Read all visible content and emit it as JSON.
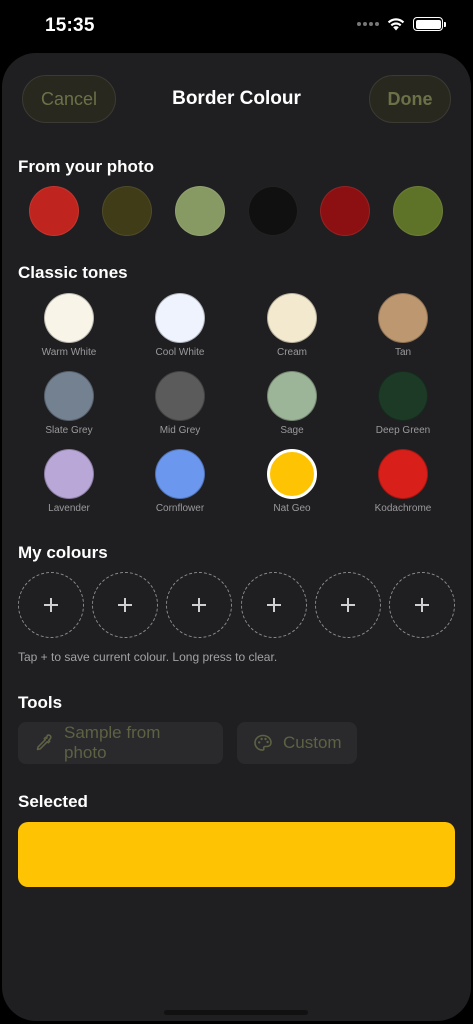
{
  "status_bar": {
    "time": "15:35"
  },
  "header": {
    "title": "Border Colour",
    "cancel_label": "Cancel",
    "done_label": "Done"
  },
  "photo_section": {
    "title": "From your photo",
    "swatches": [
      "#c0241e",
      "#3f3c17",
      "#889a64",
      "#0f100f",
      "#8c1012",
      "#5f7328"
    ]
  },
  "classic_section": {
    "title": "Classic tones",
    "tones": [
      {
        "label": "Warm White",
        "color": "#f8f4e8"
      },
      {
        "label": "Cool White",
        "color": "#eef3fd"
      },
      {
        "label": "Cream",
        "color": "#f2e9cf"
      },
      {
        "label": "Tan",
        "color": "#bc9770"
      },
      {
        "label": "Slate Grey",
        "color": "#738191"
      },
      {
        "label": "Mid Grey",
        "color": "#5b5b5b"
      },
      {
        "label": "Sage",
        "color": "#9cb497"
      },
      {
        "label": "Deep Green",
        "color": "#1c3a26"
      },
      {
        "label": "Lavender",
        "color": "#b9a7d8"
      },
      {
        "label": "Cornflower",
        "color": "#6b97ee"
      },
      {
        "label": "Nat Geo",
        "color": "#fec303",
        "selected": true
      },
      {
        "label": "Kodachrome",
        "color": "#d81f1a"
      }
    ]
  },
  "my_colours": {
    "title": "My colours",
    "slots": 6,
    "hint": "Tap + to save current colour. Long press to clear."
  },
  "tools": {
    "title": "Tools",
    "sample_label": "Sample from photo",
    "custom_label": "Custom",
    "sample_icon": "eyedropper-icon",
    "custom_icon": "palette-icon"
  },
  "selected": {
    "title": "Selected",
    "color": "#fec303"
  }
}
